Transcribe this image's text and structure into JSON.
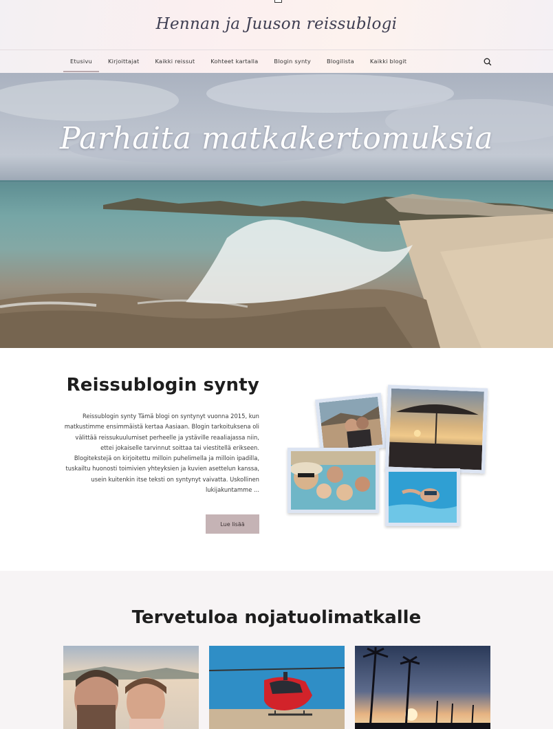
{
  "site": {
    "title": "Hennan ja Juuson reissublogi"
  },
  "nav": {
    "items": [
      {
        "label": "Etusivu",
        "active": true
      },
      {
        "label": "Kirjoittajat"
      },
      {
        "label": "Kaikki reissut"
      },
      {
        "label": "Kohteet kartalla"
      },
      {
        "label": "Blogin synty"
      },
      {
        "label": "Blogilista"
      },
      {
        "label": "Kaikki blogit"
      }
    ],
    "search_icon": "search-icon"
  },
  "hero": {
    "title": "Parhaita matkakertomuksia"
  },
  "about": {
    "heading": "Reissublogin synty",
    "text": "Reissublogin synty Tämä blogi on syntynyt vuonna 2015, kun matkustimme ensimmäistä kertaa Aasiaan. Blogin tarkoituksena oli välittää reissukuulumiset perheelle ja ystäville reaaliajassa niin, ettei jokaiselle tarvinnut soittaa tai viestitellä erikseen. Blogitekstejä on kirjoitettu milloin puhelimella ja milloin ipadilla, tuskailtu huonosti toimivien yhteyksien ja kuvien asettelun kanssa, usein kuitenkin itse teksti on syntynyt vaivatta. Uskollinen lukijakuntamme ...",
    "read_more_label": "Lue lisää"
  },
  "welcome": {
    "heading": "Tervetuloa nojatuolimatkalle"
  },
  "colors": {
    "accent": "#c5b3b5",
    "nav_underline": "#b9a9ad",
    "photo_frame": "#dce4f2",
    "welcome_bg": "#f7f4f5"
  }
}
